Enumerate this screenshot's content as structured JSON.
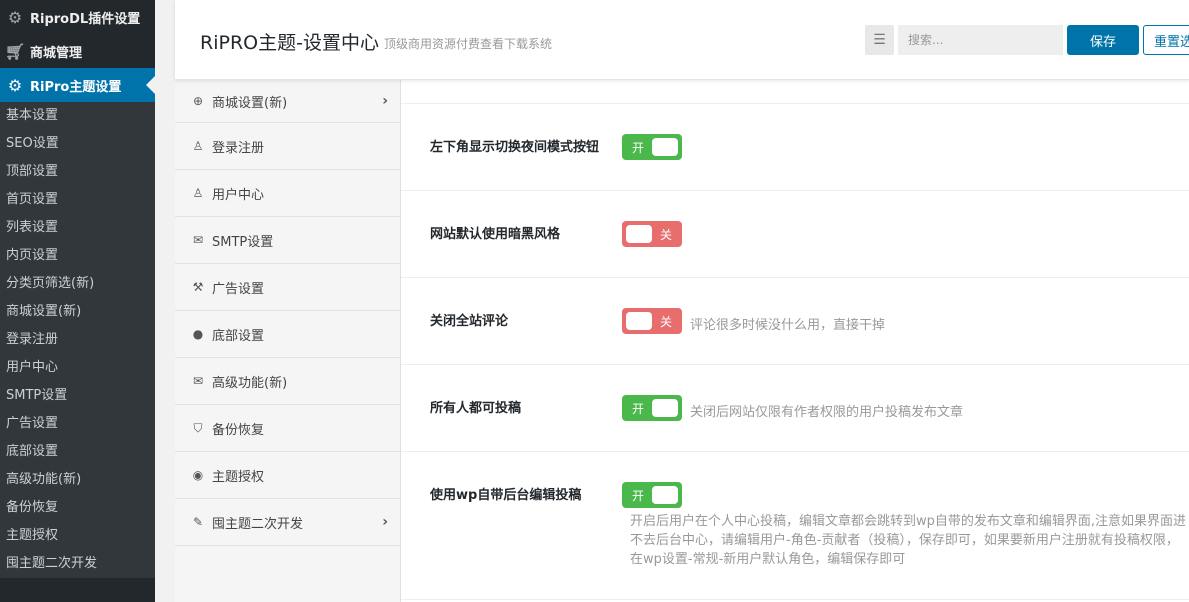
{
  "wp_sidebar": {
    "top_items": [
      {
        "label": "RiproDL插件设置",
        "icon": "gear-icon"
      },
      {
        "label": "商城管理",
        "icon": "cart-icon"
      },
      {
        "label": "RiPro主题设置",
        "icon": "gear-icon"
      }
    ],
    "submenu": [
      "基本设置",
      "SEO设置",
      "顶部设置",
      "首页设置",
      "列表设置",
      "内页设置",
      "分类页筛选(新)",
      "商城设置(新)",
      "登录注册",
      "用户中心",
      "SMTP设置",
      "广告设置",
      "底部设置",
      "高级功能(新)",
      "备份恢复",
      "主题授权",
      "囤主题二次开发"
    ]
  },
  "header": {
    "title": "RiPRO主题-设置中心",
    "subtitle": "顶级商用资源付费查看下载系统",
    "search_placeholder": "搜索...",
    "save_label": "保存",
    "reset_label": "重置选项"
  },
  "panel_nav": [
    {
      "label": "商城设置(新)",
      "icon": "plus-circle-icon",
      "chevron": true
    },
    {
      "label": "登录注册",
      "icon": "user-icon",
      "chevron": false
    },
    {
      "label": "用户中心",
      "icon": "user-icon",
      "chevron": false
    },
    {
      "label": "SMTP设置",
      "icon": "envelope-icon",
      "chevron": false
    },
    {
      "label": "广告设置",
      "icon": "gavel-icon",
      "chevron": false
    },
    {
      "label": "底部设置",
      "icon": "circle-icon",
      "chevron": false
    },
    {
      "label": "高级功能(新)",
      "icon": "envelope-icon",
      "chevron": false
    },
    {
      "label": "备份恢复",
      "icon": "shield-icon",
      "chevron": false
    },
    {
      "label": "主题授权",
      "icon": "eye-icon",
      "chevron": false
    },
    {
      "label": "囤主题二次开发",
      "icon": "magic-wand-icon",
      "chevron": true
    }
  ],
  "fields": [
    {
      "label": "左下角显示切换夜间模式按钮",
      "state": "on",
      "state_text": "开",
      "desc": ""
    },
    {
      "label": "网站默认使用暗黑风格",
      "state": "off",
      "state_text": "关",
      "desc": ""
    },
    {
      "label": "关闭全站评论",
      "state": "off",
      "state_text": "关",
      "desc": "评论很多时候没什么用，直接干掉"
    },
    {
      "label": "所有人都可投稿",
      "state": "on",
      "state_text": "开",
      "desc": "关闭后网站仅限有作者权限的用户投稿发布文章"
    },
    {
      "label": "使用wp自带后台编辑投稿",
      "state": "on",
      "state_text": "开",
      "desc_long": "开启后用户在个人中心投稿，编辑文章都会跳转到wp自带的发布文章和编辑界面,注意如果界面进不去后台中心，请编辑用户-角色-贡献者（投稿），保存即可，如果要新用户注册就有投稿权限，在wp设置-常规-新用户默认角色，编辑保存即可"
    }
  ]
}
